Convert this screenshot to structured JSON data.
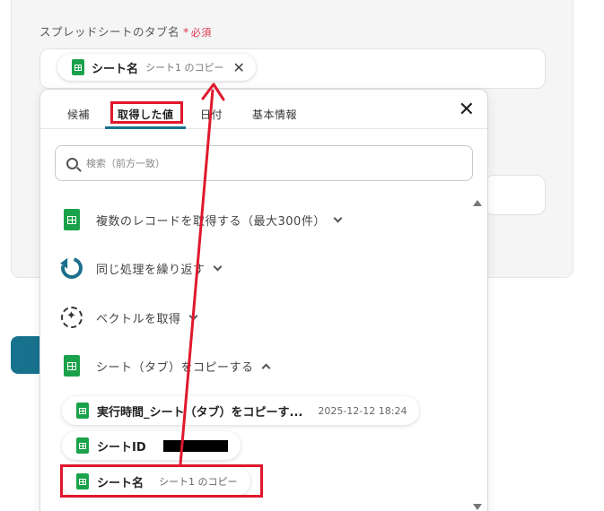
{
  "form": {
    "field_label": "スプレッドシートのタブ名",
    "required_star": "*",
    "required_text": "必須",
    "chip": {
      "label": "シート名",
      "sublabel": "シート1 のコピー",
      "icon": "sheet-icon"
    }
  },
  "dropdown": {
    "tabs": [
      {
        "label": "候補"
      },
      {
        "label": "取得した値",
        "active": true
      },
      {
        "label": "日付"
      },
      {
        "label": "基本情報"
      }
    ],
    "search_placeholder": "検索（前方一致）",
    "sections": [
      {
        "label": "複数のレコードを取得する（最大300件）",
        "icon": "sheet-icon",
        "expanded": false
      },
      {
        "label": "同じ処理を繰り返す",
        "icon": "loop-icon",
        "expanded": false
      },
      {
        "label": "ベクトルを取得",
        "icon": "vector-icon",
        "expanded": false
      },
      {
        "label": "シート（タブ）をコピーする",
        "icon": "sheet-icon",
        "expanded": true
      }
    ],
    "items": [
      {
        "label": "実行時間_シート（タブ）をコピーす...",
        "value": "2025-12-12 18:24"
      },
      {
        "label": "シートID",
        "value": ""
      },
      {
        "label": "シート名",
        "value": "シート1 のコピー"
      }
    ]
  },
  "colors": {
    "accent": "#18728e",
    "highlight": "#e0182d",
    "required": "#e0344a",
    "sheet_green": "#1aa24b"
  }
}
